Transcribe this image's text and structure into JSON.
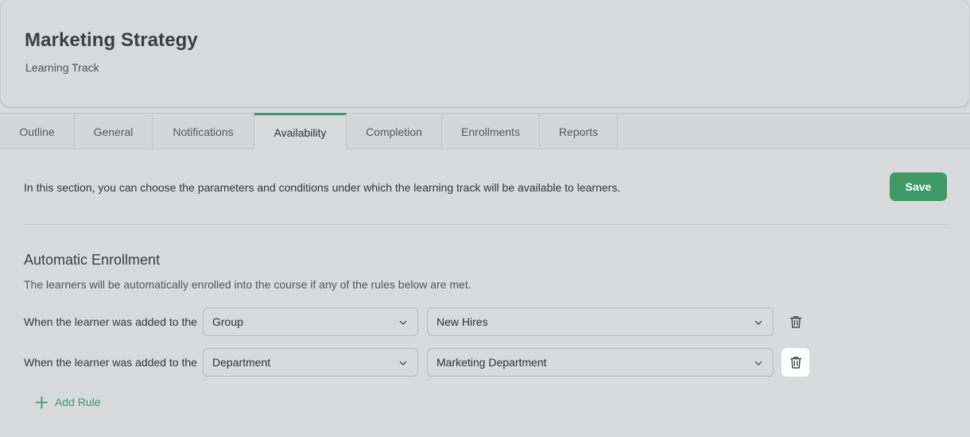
{
  "header": {
    "title": "Marketing Strategy",
    "subtitle": "Learning Track"
  },
  "tabs": [
    {
      "label": "Outline",
      "active": false
    },
    {
      "label": "General",
      "active": false
    },
    {
      "label": "Notifications",
      "active": false
    },
    {
      "label": "Availability",
      "active": true
    },
    {
      "label": "Completion",
      "active": false
    },
    {
      "label": "Enrollments",
      "active": false
    },
    {
      "label": "Reports",
      "active": false
    }
  ],
  "availability": {
    "intro": "In this section, you can choose the parameters and conditions under which the learning track will be available to learners.",
    "save_label": "Save",
    "section_title": "Automatic Enrollment",
    "section_desc": "The learners will be automatically enrolled into the course if any of the rules below are met.",
    "rules": [
      {
        "label": "When the learner was added to the",
        "type": "Group",
        "value": "New Hires"
      },
      {
        "label": "When the learner was added to the",
        "type": "Department",
        "value": "Marketing Department"
      }
    ],
    "add_rule_label": "Add Rule"
  },
  "icons": {
    "chevron": "chevron-down-icon",
    "delete": "trash-icon",
    "add": "plus-icon"
  },
  "colors": {
    "accent": "#3f9a68",
    "background": "#d9dadb"
  }
}
